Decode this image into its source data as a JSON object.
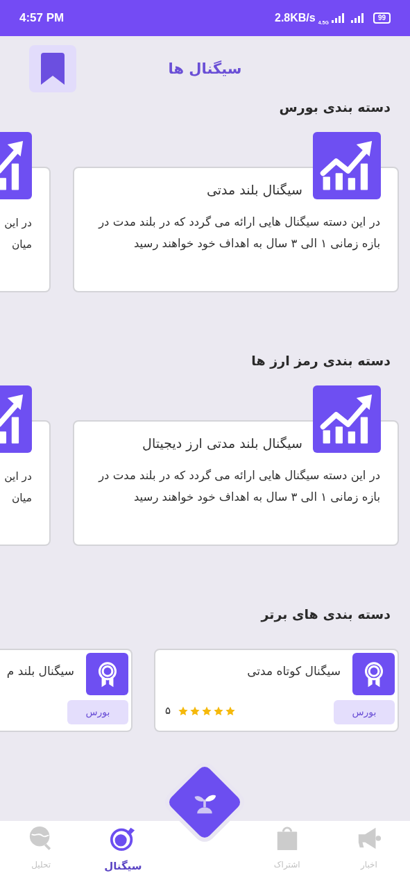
{
  "status_bar": {
    "time": "4:57 PM",
    "speed": "2.8KB/s",
    "network": "4.5G",
    "battery": "99"
  },
  "header": {
    "title": "سیگنال ها"
  },
  "sections": [
    {
      "heading": "دسته بندی بورس",
      "kind": "wide",
      "cards": [
        {
          "title": "سیگنال بلند مدتی",
          "description": "در این دسته سیگنال هایی ارائه می گردد که در بلند مدت در بازه زمانی ۱ الی ۳ سال به اهداف خود خواهند رسید"
        },
        {
          "visible_lines": [
            "در این",
            "میان"
          ]
        }
      ]
    },
    {
      "heading": "دسته بندی رمز ارز ها",
      "kind": "wide",
      "cards": [
        {
          "title": "سیگنال  بلند مدتی ارز دیجیتال",
          "description": "در این دسته سیگنال هایی ارائه می گردد که در بلند مدت در بازه زمانی ۱ الی ۳ سال به اهداف خود خواهند رسید"
        },
        {
          "visible_lines": [
            "در این",
            "میان"
          ]
        }
      ]
    },
    {
      "heading": "دسته بندی های برتر",
      "kind": "compact",
      "cards": [
        {
          "title": "سیگنال کوتاه مدتی",
          "badge": "بورس",
          "stars": 5,
          "rating": "۵"
        },
        {
          "title": "سیگنال بلند م",
          "badge": "بورس"
        }
      ]
    }
  ],
  "nav": [
    {
      "label": "اخبار",
      "selected": false
    },
    {
      "label": "اشتراک",
      "selected": false
    },
    {
      "label": "سیگنال",
      "selected": true
    },
    {
      "label": "تحلیل",
      "selected": false
    }
  ]
}
